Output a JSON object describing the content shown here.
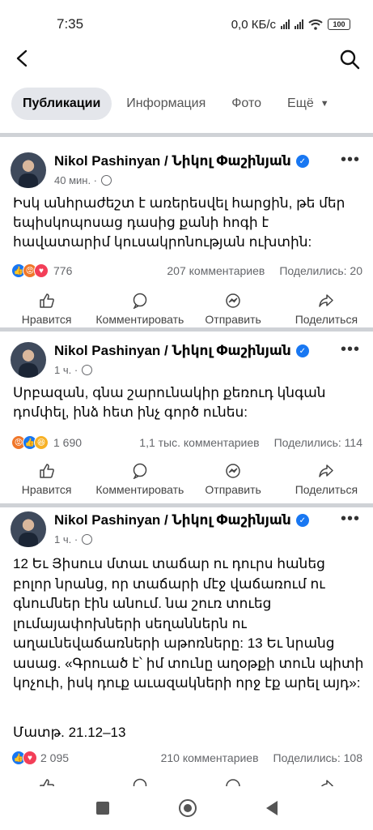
{
  "status": {
    "time": "7:35",
    "net": "0,0 КБ/с",
    "battery": "100"
  },
  "tabs": [
    {
      "label": "Публикации"
    },
    {
      "label": "Информация"
    },
    {
      "label": "Фото"
    },
    {
      "label": "Ещё"
    }
  ],
  "actions": {
    "like": "Нравится",
    "comment": "Комментировать",
    "send": "Отправить",
    "share": "Поделиться"
  },
  "posts": [
    {
      "author": "Nikol Pashinyan / Նիկոլ Փաշինյան",
      "time": "40 мин. ·",
      "text": "Իսկ անհրաժեշտ է առերեսվել հարցին, թե մեր եպիսկոպոսաց դասից քանի հոգի է հավատարիմ կուսակրոնության ուխտին:",
      "reactions_count": "776",
      "comments": "207 комментариев",
      "shares": "Поделились: 20"
    },
    {
      "author": "Nikol Pashinyan / Նիկոլ Փաշինյան",
      "time": "1 ч. ·",
      "text": "Սրբազան, գնա շարունակիր քեռուդ կնգան դոմփել, ինձ հետ ինչ գործ ունես:",
      "reactions_count": "1 690",
      "comments": "1,1 тыс. комментариев",
      "shares": "Поделились: 114"
    },
    {
      "author": "Nikol Pashinyan / Նիկոլ Փաշինյան",
      "time": "1 ч. ·",
      "text": "12 Եւ Յիսուս մտաւ տաճար ու դուրս հանեց բոլոր նրանց, որ տաճարի մէջ վաճառում ու գնումներ էին անում. նա շուռ տուեց լումայափոխների սեղաններն ու աղաւնեվաճառների աթոռները: 13 Եւ նրանց ասաց. «Գրուած է՝ իմ տունը աղօթքի տուն պիտի կոչուի, իսկ դուք աւազակների որջ էք արել այդ»:",
      "ref": "Մատթ. 21.12–13",
      "reactions_count": "2 095",
      "comments": "210 комментариев",
      "shares": "Поделились: 108"
    }
  ]
}
